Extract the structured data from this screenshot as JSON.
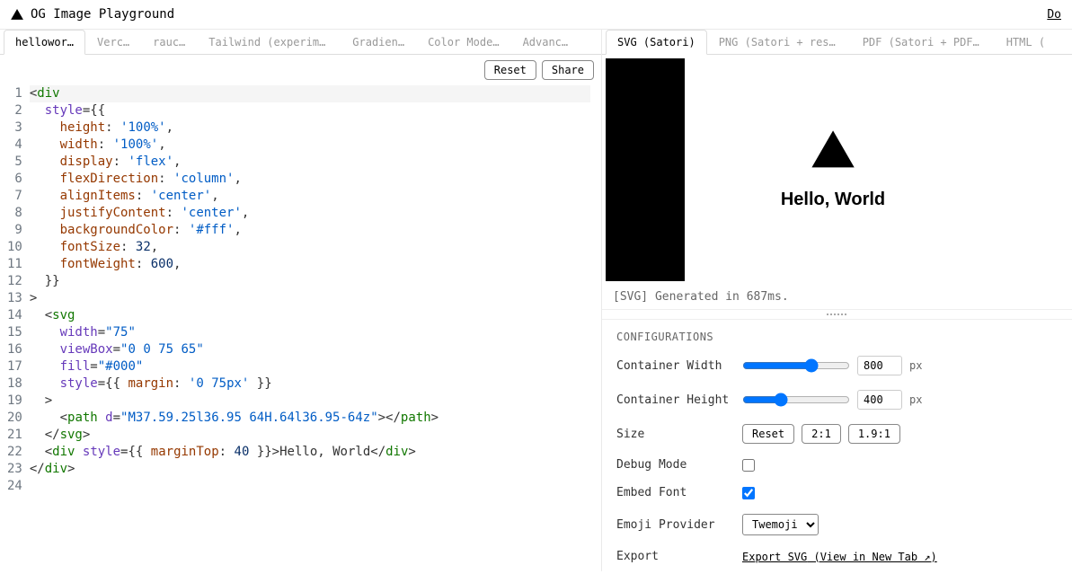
{
  "header": {
    "title": "OG Image Playground",
    "docs": "Do"
  },
  "left": {
    "tabs": [
      {
        "label": "hellowor…",
        "active": true
      },
      {
        "label": "Verc…",
        "active": false
      },
      {
        "label": "rauc…",
        "active": false
      },
      {
        "label": "Tailwind (experiment…",
        "active": false
      },
      {
        "label": "Gradien…",
        "active": false
      },
      {
        "label": "Color Mode…",
        "active": false
      },
      {
        "label": "Advanc…",
        "active": false
      }
    ],
    "toolbar": {
      "reset": "Reset",
      "share": "Share"
    },
    "code": {
      "lines": [
        {
          "n": 1,
          "hl": true,
          "html": "<span class='tok-angle'>&lt;</span><span class='tok-tag'>div</span>"
        },
        {
          "n": 2,
          "hl": false,
          "html": "  <span class='tok-attr'>style</span><span class='tok-punc'>={{</span>"
        },
        {
          "n": 3,
          "hl": false,
          "html": "    <span class='tok-prop'>height</span><span class='tok-punc'>:</span> <span class='tok-str'>'100%'</span><span class='tok-punc'>,</span>"
        },
        {
          "n": 4,
          "hl": false,
          "html": "    <span class='tok-prop'>width</span><span class='tok-punc'>:</span> <span class='tok-str'>'100%'</span><span class='tok-punc'>,</span>"
        },
        {
          "n": 5,
          "hl": false,
          "html": "    <span class='tok-prop'>display</span><span class='tok-punc'>:</span> <span class='tok-str'>'flex'</span><span class='tok-punc'>,</span>"
        },
        {
          "n": 6,
          "hl": false,
          "html": "    <span class='tok-prop'>flexDirection</span><span class='tok-punc'>:</span> <span class='tok-str'>'column'</span><span class='tok-punc'>,</span>"
        },
        {
          "n": 7,
          "hl": false,
          "html": "    <span class='tok-prop'>alignItems</span><span class='tok-punc'>:</span> <span class='tok-str'>'center'</span><span class='tok-punc'>,</span>"
        },
        {
          "n": 8,
          "hl": false,
          "html": "    <span class='tok-prop'>justifyContent</span><span class='tok-punc'>:</span> <span class='tok-str'>'center'</span><span class='tok-punc'>,</span>"
        },
        {
          "n": 9,
          "hl": false,
          "html": "    <span class='tok-prop'>backgroundColor</span><span class='tok-punc'>:</span> <span class='tok-str'>'#fff'</span><span class='tok-punc'>,</span>"
        },
        {
          "n": 10,
          "hl": false,
          "html": "    <span class='tok-prop'>fontSize</span><span class='tok-punc'>:</span> <span class='tok-num'>32</span><span class='tok-punc'>,</span>"
        },
        {
          "n": 11,
          "hl": false,
          "html": "    <span class='tok-prop'>fontWeight</span><span class='tok-punc'>:</span> <span class='tok-num'>600</span><span class='tok-punc'>,</span>"
        },
        {
          "n": 12,
          "hl": false,
          "html": "  <span class='tok-punc'>}}</span>"
        },
        {
          "n": 13,
          "hl": false,
          "html": "<span class='tok-angle'>&gt;</span>"
        },
        {
          "n": 14,
          "hl": false,
          "html": "  <span class='tok-angle'>&lt;</span><span class='tok-tag'>svg</span>"
        },
        {
          "n": 15,
          "hl": false,
          "html": "    <span class='tok-attr'>width</span><span class='tok-punc'>=</span><span class='tok-str'>\"75\"</span>"
        },
        {
          "n": 16,
          "hl": false,
          "html": "    <span class='tok-attr'>viewBox</span><span class='tok-punc'>=</span><span class='tok-str'>\"0 0 75 65\"</span>"
        },
        {
          "n": 17,
          "hl": false,
          "html": "    <span class='tok-attr'>fill</span><span class='tok-punc'>=</span><span class='tok-str'>\"#000\"</span>"
        },
        {
          "n": 18,
          "hl": false,
          "html": "    <span class='tok-attr'>style</span><span class='tok-punc'>={{</span> <span class='tok-prop'>margin</span><span class='tok-punc'>:</span> <span class='tok-str'>'0 75px'</span> <span class='tok-punc'>}}</span>"
        },
        {
          "n": 19,
          "hl": false,
          "html": "  <span class='tok-angle'>&gt;</span>"
        },
        {
          "n": 20,
          "hl": false,
          "html": "    <span class='tok-angle'>&lt;</span><span class='tok-tag'>path</span> <span class='tok-attr'>d</span><span class='tok-punc'>=</span><span class='tok-str'>\"M37.59.25l36.95 64H.64l36.95-64z\"</span><span class='tok-angle'>&gt;&lt;/</span><span class='tok-tag'>path</span><span class='tok-angle'>&gt;</span>"
        },
        {
          "n": 21,
          "hl": false,
          "html": "  <span class='tok-angle'>&lt;/</span><span class='tok-tag'>svg</span><span class='tok-angle'>&gt;</span>"
        },
        {
          "n": 22,
          "hl": false,
          "html": "  <span class='tok-angle'>&lt;</span><span class='tok-tag'>div</span> <span class='tok-attr'>style</span><span class='tok-punc'>={{</span> <span class='tok-prop'>marginTop</span><span class='tok-punc'>:</span> <span class='tok-num'>40</span> <span class='tok-punc'>}}</span><span class='tok-angle'>&gt;</span><span class='tok-txt'>Hello, World</span><span class='tok-angle'>&lt;/</span><span class='tok-tag'>div</span><span class='tok-angle'>&gt;</span>"
        },
        {
          "n": 23,
          "hl": false,
          "html": "<span class='tok-angle'>&lt;/</span><span class='tok-tag'>div</span><span class='tok-angle'>&gt;</span>"
        },
        {
          "n": 24,
          "hl": false,
          "html": ""
        }
      ]
    }
  },
  "right": {
    "tabs": [
      {
        "label": "SVG (Satori)",
        "active": true
      },
      {
        "label": "PNG (Satori + resvg-js)",
        "active": false
      },
      {
        "label": "PDF (Satori + PDFKit)",
        "active": false
      },
      {
        "label": "HTML (",
        "active": false
      }
    ],
    "preview_text": "Hello, World",
    "status": "[SVG] Generated in 687ms.",
    "config": {
      "title": "CONFIGURATIONS",
      "width": {
        "label": "Container Width",
        "value": "800",
        "unit": "px",
        "min": 0,
        "max": 1200
      },
      "height": {
        "label": "Container Height",
        "value": "400",
        "unit": "px",
        "min": 0,
        "max": 1200
      },
      "size": {
        "label": "Size",
        "reset": "Reset",
        "ratio1": "2:1",
        "ratio2": "1.9:1"
      },
      "debug": {
        "label": "Debug Mode",
        "checked": false
      },
      "embed": {
        "label": "Embed Font",
        "checked": true
      },
      "emoji": {
        "label": "Emoji Provider",
        "selected": "Twemoji"
      },
      "export": {
        "label": "Export",
        "link": "Export SVG",
        "new_tab": "(View in New Tab ↗)"
      }
    }
  }
}
